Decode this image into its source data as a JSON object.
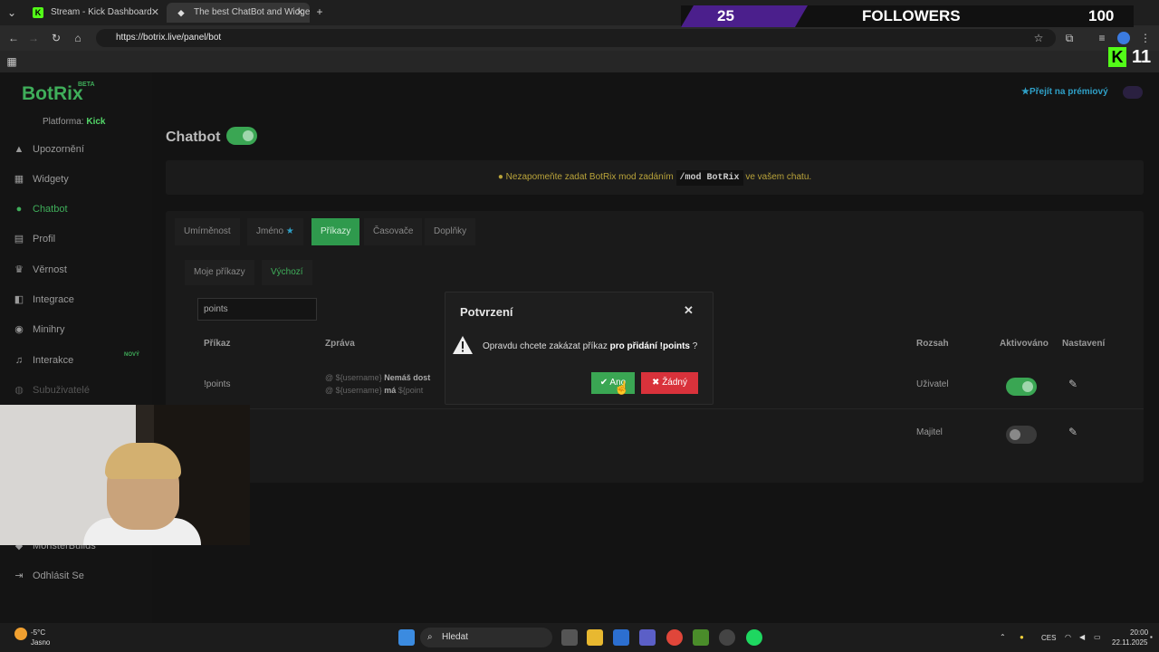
{
  "browser": {
    "tabs": [
      {
        "title": "Stream - Kick Dashboard",
        "favicon": "kick-icon"
      },
      {
        "title": "The best ChatBot and Widgets",
        "favicon": "botrix-icon"
      }
    ],
    "url": "https://botrix.live/panel/bot"
  },
  "overlay": {
    "followers_count": "25",
    "followers_label": "FOLLOWERS",
    "followers_goal": "100",
    "kick_viewers": "11"
  },
  "sidebar": {
    "logo": "BotRix",
    "beta": "BETA",
    "platform_label": "Platforma:",
    "platform_value": "Kick",
    "items": [
      {
        "label": "Upozornění",
        "icon": "warning-icon"
      },
      {
        "label": "Widgety",
        "icon": "grid-icon"
      },
      {
        "label": "Chatbot",
        "icon": "robot-icon"
      },
      {
        "label": "Profil",
        "icon": "id-card-icon"
      },
      {
        "label": "Věrnost",
        "icon": "trophy-icon"
      },
      {
        "label": "Integrace",
        "icon": "plug-icon"
      },
      {
        "label": "Minihry",
        "icon": "gamepad-icon"
      },
      {
        "label": "Interakce",
        "icon": "music-icon"
      },
      {
        "label": "Subuživatelé",
        "icon": "users-icon"
      },
      {
        "label": "MonsterBuilds",
        "icon": "monster-icon"
      },
      {
        "label": "Odhlásit Se",
        "icon": "logout-icon"
      }
    ],
    "new_badge": "NOVÝ"
  },
  "header": {
    "premium": "Přejít na prémiový"
  },
  "main": {
    "title": "Chatbot",
    "notice_before": "Nezapomeňte zadat BotRix mod zadáním",
    "notice_code": "/mod BotRix",
    "notice_after": "ve vašem chatu.",
    "tabs": [
      "Umírněnost",
      "Jméno",
      "Příkazy",
      "Časovače",
      "Doplňky"
    ],
    "subtabs": [
      "Moje příkazy",
      "Výchozí"
    ],
    "search_value": "points",
    "columns": [
      "Příkaz",
      "Zpráva",
      "Rozsah",
      "Aktivováno",
      "Nastavení"
    ],
    "rows": [
      {
        "command": "!points",
        "msg1_user": "${username}",
        "msg1_text": "Nemáš dost",
        "msg2_user": "${username}",
        "msg2_text": "má",
        "msg2_extra": "${point",
        "scope": "Uživatel",
        "active": true
      },
      {
        "command": "",
        "scope": "Majitel",
        "active": false
      }
    ]
  },
  "modal": {
    "title": "Potvrzení",
    "text_before": "Opravdu chcete zakázat příkaz",
    "text_bold": "pro přidání !points",
    "text_after": "?",
    "yes": "Ano",
    "no": "Žádný"
  },
  "taskbar": {
    "weather_temp": "-5°C",
    "weather_desc": "Jasno",
    "search": "Hledat",
    "lang": "CES",
    "time": "20:00",
    "date": "22.11.2025"
  },
  "colors": {
    "accent": "#3aa653",
    "danger": "#d9323b",
    "notice": "#b9a33a"
  }
}
